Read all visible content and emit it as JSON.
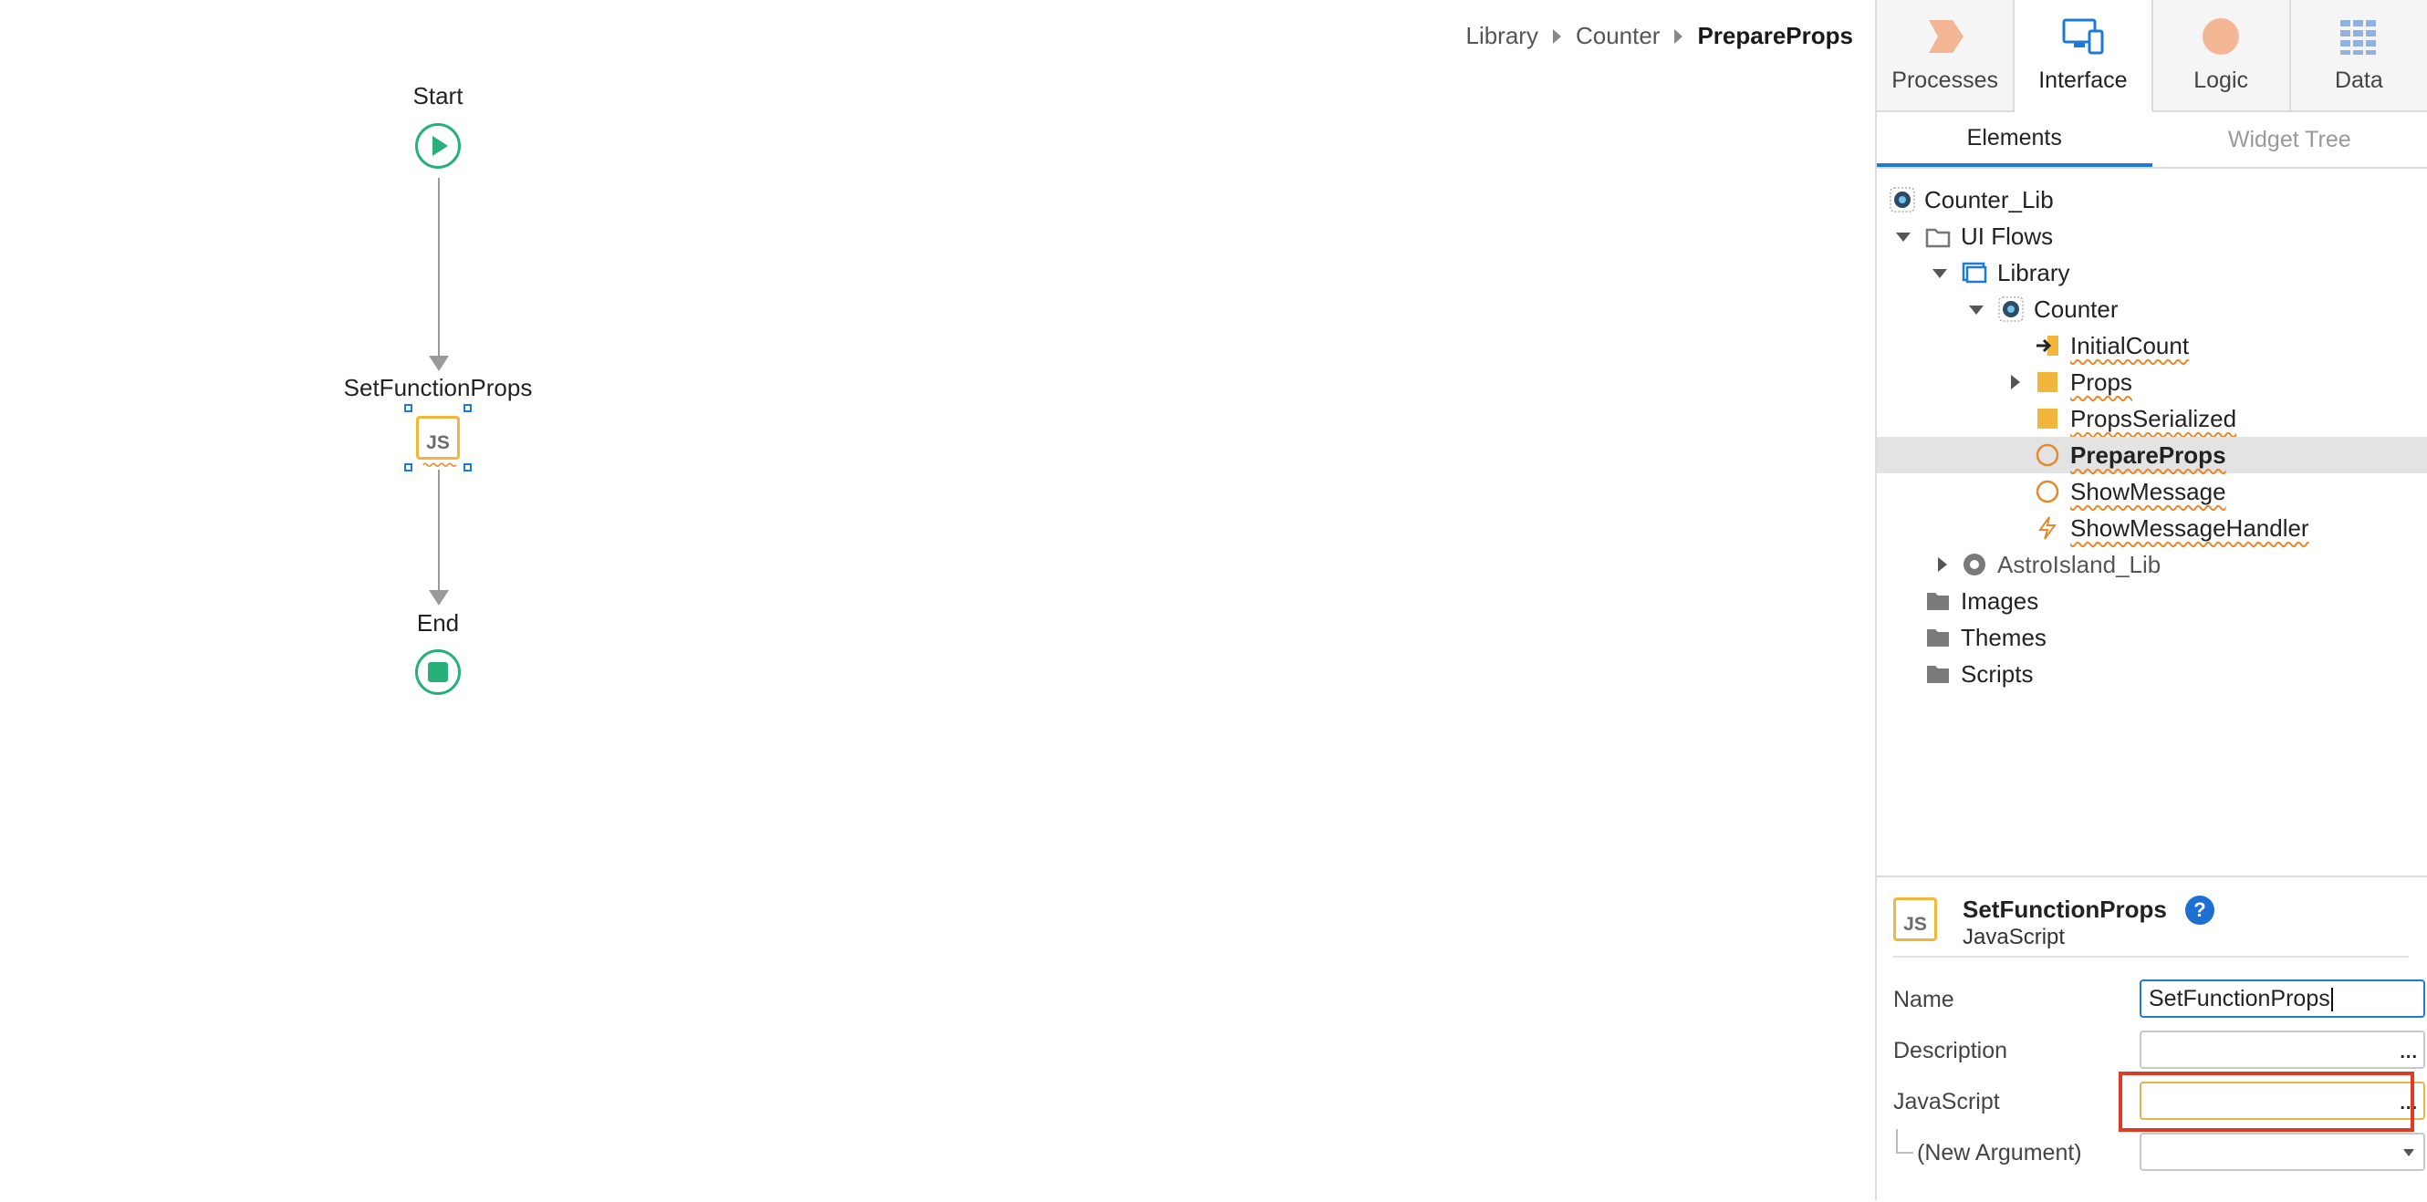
{
  "breadcrumb": {
    "items": [
      "Library",
      "Counter"
    ],
    "current": "PrepareProps"
  },
  "flow": {
    "start_label": "Start",
    "js_node_label": "SetFunctionProps",
    "js_node_text": "JS",
    "end_label": "End"
  },
  "top_tabs": [
    {
      "label": "Processes",
      "icon": "processes-icon"
    },
    {
      "label": "Interface",
      "icon": "interface-icon",
      "active": true
    },
    {
      "label": "Logic",
      "icon": "logic-icon"
    },
    {
      "label": "Data",
      "icon": "data-icon"
    }
  ],
  "sub_tabs": {
    "elements": "Elements",
    "widget_tree": "Widget Tree"
  },
  "tree": {
    "root": "Counter_Lib",
    "ui_flows": "UI Flows",
    "library": "Library",
    "counter": "Counter",
    "initial_count": "InitialCount",
    "props": "Props",
    "props_serialized": "PropsSerialized",
    "prepare_props": "PrepareProps",
    "show_message": "ShowMessage",
    "show_message_handler": "ShowMessageHandler",
    "astro_island": "AstroIsland_Lib",
    "images": "Images",
    "themes": "Themes",
    "scripts": "Scripts"
  },
  "properties": {
    "title": "SetFunctionProps",
    "subtitle": "JavaScript",
    "icon_text": "JS",
    "help": "?",
    "name_label": "Name",
    "name_value": "SetFunctionProps",
    "description_label": "Description",
    "description_value": "",
    "javascript_label": "JavaScript",
    "javascript_value": "",
    "new_argument_label": "(New Argument)",
    "ellipsis": "..."
  },
  "colors": {
    "accent_blue": "#1d7bd6",
    "start_green": "#27b07a",
    "js_yellow": "#f3b63d",
    "highlight_red": "#e03a22",
    "warning_orange": "#e6892d"
  }
}
